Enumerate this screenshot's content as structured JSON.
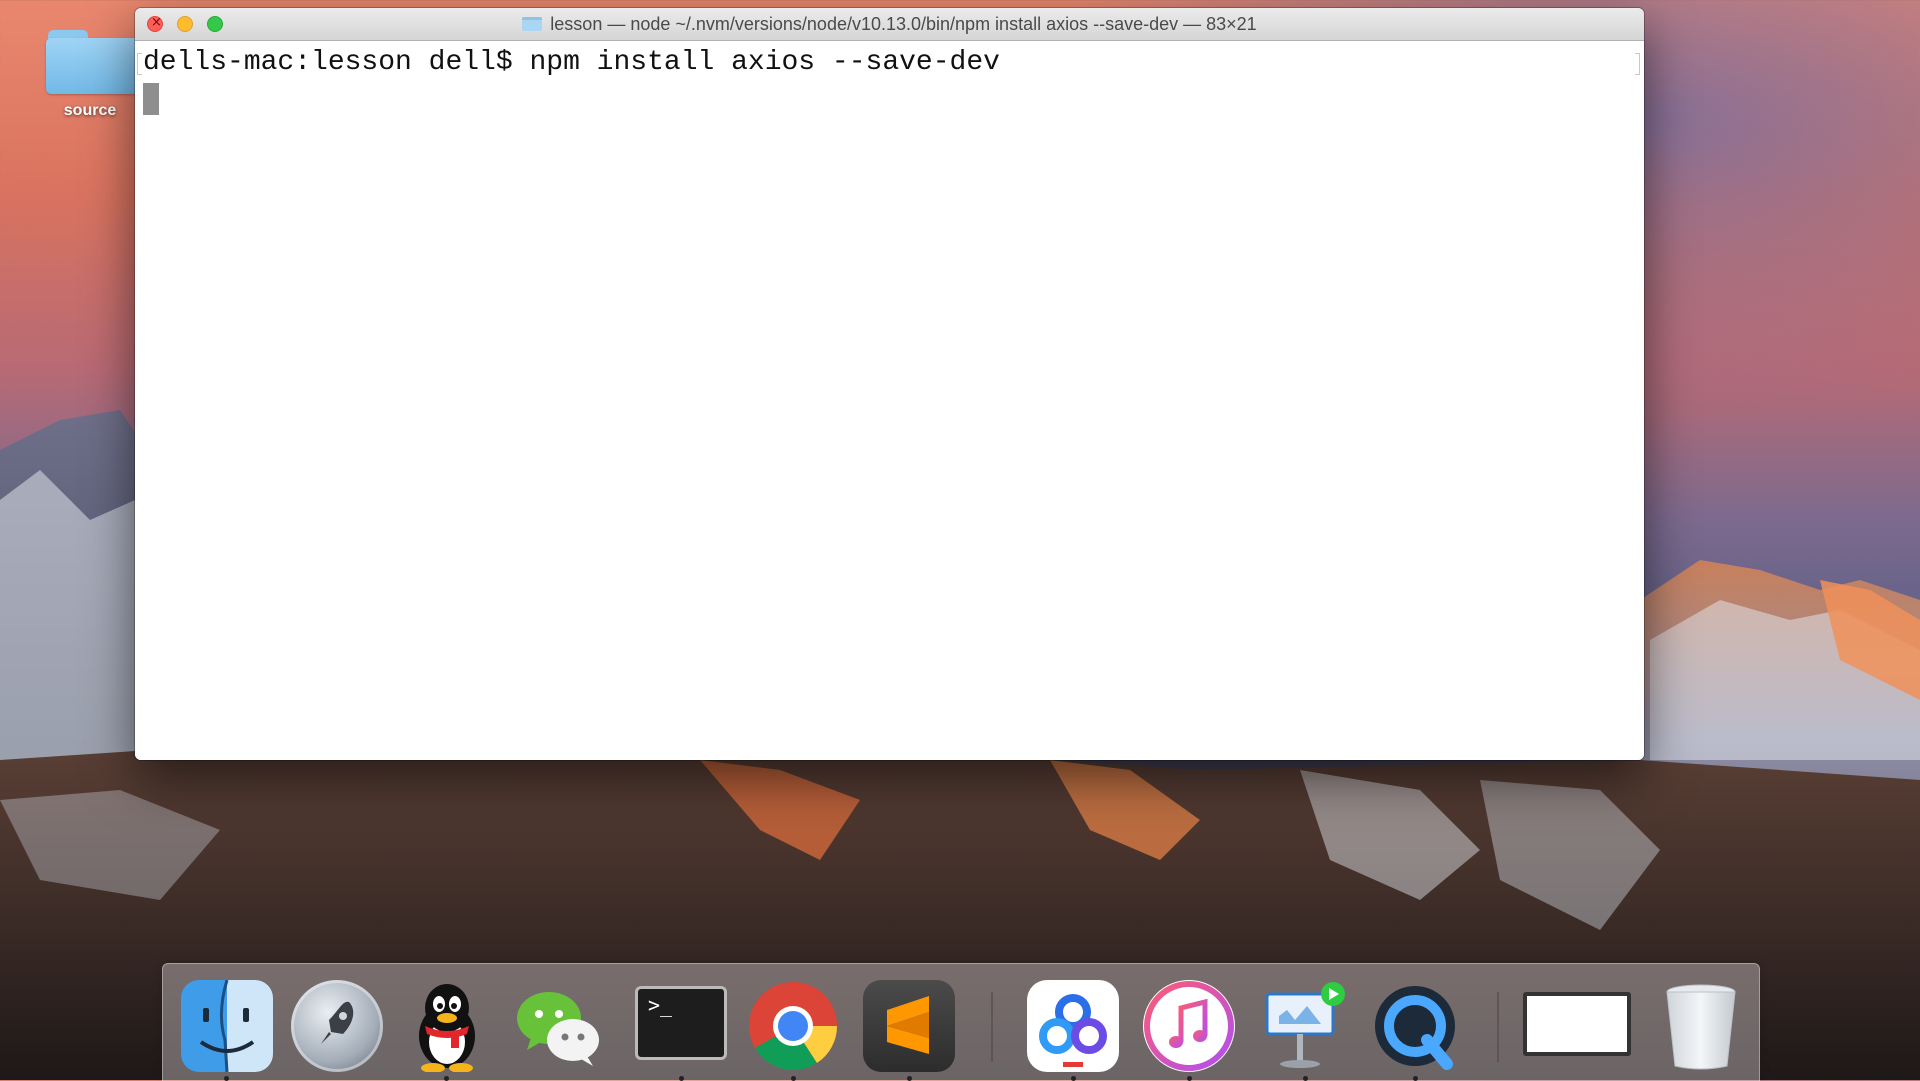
{
  "desktop": {
    "folders": [
      {
        "label": "source"
      }
    ]
  },
  "terminal_window": {
    "title": "lesson — node ~/.nvm/versions/node/v10.13.0/bin/npm install axios --save-dev — 83×21",
    "lines": [
      "dells-mac:lesson dell$ npm install axios --save-dev"
    ],
    "cursor_visible": true
  },
  "dock": {
    "apps": [
      {
        "name": "Finder",
        "icon": "finder-icon",
        "running": true
      },
      {
        "name": "Launchpad",
        "icon": "launchpad-icon",
        "running": false
      },
      {
        "name": "QQ",
        "icon": "qq-icon",
        "running": true
      },
      {
        "name": "WeChat",
        "icon": "wechat-icon",
        "running": false
      },
      {
        "name": "Terminal",
        "icon": "terminal-icon",
        "running": true
      },
      {
        "name": "Google Chrome",
        "icon": "chrome-icon",
        "running": true
      },
      {
        "name": "Sublime Text",
        "icon": "sublime-icon",
        "running": true
      },
      {
        "name": "Baidu Netdisk",
        "icon": "baidu-netdisk-icon",
        "running": true
      },
      {
        "name": "iTunes",
        "icon": "itunes-icon",
        "running": true
      },
      {
        "name": "Keynote",
        "icon": "keynote-icon",
        "running": true
      },
      {
        "name": "QuickTime Player",
        "icon": "quicktime-icon",
        "running": true
      },
      {
        "name": "Window",
        "icon": "minimized-window-icon",
        "running": false
      },
      {
        "name": "Trash",
        "icon": "trash-icon",
        "running": false
      }
    ]
  },
  "colors": {
    "terminal_background": "#ffffff",
    "close": "#fc5f57",
    "minimize": "#fdbc2e",
    "zoom": "#34c84a"
  }
}
